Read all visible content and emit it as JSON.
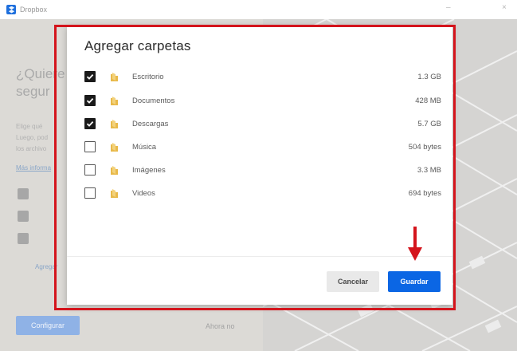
{
  "window": {
    "title": "Dropbox",
    "minimize_glyph": "–",
    "close_glyph": "×"
  },
  "background": {
    "heading_line1": "¿Quiere",
    "heading_line2": "segur",
    "text_line1": "Elige qué",
    "text_line2": "Luego, pod",
    "text_line3": "los archivo",
    "link": "Más informa",
    "add_link": "Agregar",
    "configure_button": "Configurar",
    "later_button": "Ahora no"
  },
  "modal": {
    "title": "Agregar carpetas",
    "folders": [
      {
        "name": "Escritorio",
        "size": "1.3 GB",
        "checked": true
      },
      {
        "name": "Documentos",
        "size": "428 MB",
        "checked": true
      },
      {
        "name": "Descargas",
        "size": "5.7 GB",
        "checked": true
      },
      {
        "name": "Música",
        "size": "504 bytes",
        "checked": false
      },
      {
        "name": "Imágenes",
        "size": "3.3 MB",
        "checked": false
      },
      {
        "name": "Videos",
        "size": "694 bytes",
        "checked": false
      }
    ],
    "cancel_label": "Cancelar",
    "save_label": "Guardar"
  },
  "colors": {
    "accent": "#0b66e4",
    "highlight": "#d4141c",
    "folder": "#e8b94a"
  },
  "icons": [
    "dropbox-logo-icon",
    "checkmark-icon",
    "folder-icon",
    "down-arrow-icon"
  ]
}
